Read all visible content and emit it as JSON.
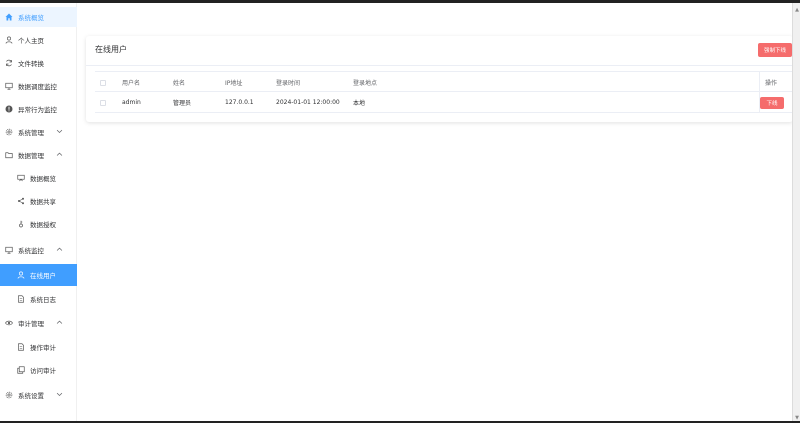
{
  "sidebar": {
    "items": [
      {
        "label": "系统概览",
        "icon": "home-icon"
      },
      {
        "label": "个人主页",
        "icon": "user-icon"
      },
      {
        "label": "文件转换",
        "icon": "refresh-icon"
      },
      {
        "label": "数据调度监控",
        "icon": "monitor-icon"
      },
      {
        "label": "异常行为监控",
        "icon": "warning-icon"
      },
      {
        "label": "系统管理",
        "icon": "gear-icon"
      },
      {
        "label": "数据管理",
        "icon": "folder-icon"
      },
      {
        "label": "数据概览",
        "icon": "data-board-icon"
      },
      {
        "label": "数据共享",
        "icon": "share-icon"
      },
      {
        "label": "数据授权",
        "icon": "key-icon"
      },
      {
        "label": "系统监控",
        "icon": "monitor-icon"
      },
      {
        "label": "在线用户",
        "icon": "user-icon"
      },
      {
        "label": "系统日志",
        "icon": "document-icon"
      },
      {
        "label": "审计管理",
        "icon": "eye-icon"
      },
      {
        "label": "操作审计",
        "icon": "document-icon"
      },
      {
        "label": "访问审计",
        "icon": "document-copy-icon"
      },
      {
        "label": "系统设置",
        "icon": "gear-icon"
      }
    ]
  },
  "card": {
    "title": "在线用户",
    "force_logout_label": "强制下线"
  },
  "table": {
    "headers": [
      "用户名",
      "姓名",
      "IP地址",
      "登录时间",
      "登录地点",
      "操作"
    ],
    "rows": [
      {
        "username": "admin",
        "name": "管理员",
        "ip": "127.0.0.1",
        "login_time": "2024-01-01 12:00:00",
        "location": "本地",
        "action_label": "下线"
      }
    ]
  },
  "colors": {
    "accent": "#409eff",
    "danger": "#f56c6c",
    "active_bg": "#ecf5ff"
  }
}
